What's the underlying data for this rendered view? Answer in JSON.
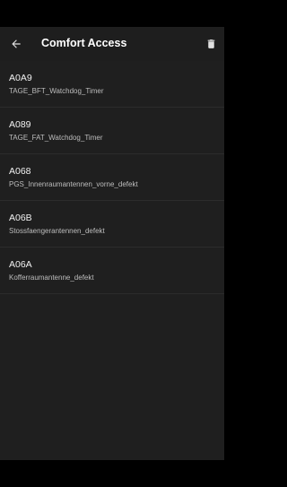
{
  "header": {
    "title": "Comfort Access",
    "back_icon": "arrow-back-icon",
    "delete_icon": "trash-icon"
  },
  "colors": {
    "app_bar": "#1e1e1e",
    "list_bg": "#1f1f1f",
    "divider": "#2c2c2c",
    "code_text": "#f2f2f2",
    "desc_text": "#bdbdbd"
  },
  "faults": [
    {
      "code": "A0A9",
      "description": "TAGE_BFT_Watchdog_Timer"
    },
    {
      "code": "A089",
      "description": "TAGE_FAT_Watchdog_Timer"
    },
    {
      "code": "A068",
      "description": "PGS_Innenraumantennen_vorne_defekt"
    },
    {
      "code": "A06B",
      "description": "Stossfaengerantennen_defekt"
    },
    {
      "code": "A06A",
      "description": "Kofferraumantenne_defekt"
    }
  ]
}
